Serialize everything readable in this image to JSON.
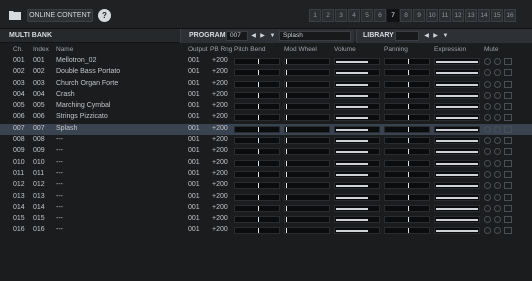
{
  "topbar": {
    "folder_icon": "folder-icon",
    "online_label": "ONLINE CONTENT",
    "help_label": "?",
    "pages": [
      "1",
      "2",
      "3",
      "4",
      "5",
      "6",
      "7",
      "8",
      "9",
      "10",
      "11",
      "12",
      "13",
      "14",
      "15",
      "16"
    ],
    "active_page": "7"
  },
  "header": {
    "multibank_label": "MULTI BANK",
    "program_label": "PROGRAM",
    "program_number": "007",
    "program_name": "Splash",
    "library_label": "LIBRARY",
    "library_value": ""
  },
  "columns": {
    "ch": "Ch.",
    "index": "Index",
    "name": "Name",
    "output": "Output",
    "pb_rng": "PB Rng",
    "pitch_bend": "Pitch Bend",
    "mod_wheel": "Mod Wheel",
    "volume": "Volume",
    "panning": "Panning",
    "expression": "Expression",
    "mute": "Mute"
  },
  "rows": [
    {
      "ch": "001",
      "index": "001",
      "name": "Mellotron_02",
      "output": "001",
      "pb": "+200"
    },
    {
      "ch": "002",
      "index": "002",
      "name": "Double Bass Portato",
      "output": "001",
      "pb": "+200"
    },
    {
      "ch": "003",
      "index": "003",
      "name": "Church Organ Forte",
      "output": "001",
      "pb": "+200"
    },
    {
      "ch": "004",
      "index": "004",
      "name": "Crash",
      "output": "001",
      "pb": "+200"
    },
    {
      "ch": "005",
      "index": "005",
      "name": "Marching Cymbal",
      "output": "001",
      "pb": "+200"
    },
    {
      "ch": "006",
      "index": "006",
      "name": "Strings Pizzicato",
      "output": "001",
      "pb": "+200"
    },
    {
      "ch": "007",
      "index": "007",
      "name": "Splash",
      "output": "001",
      "pb": "+200"
    },
    {
      "ch": "008",
      "index": "008",
      "name": "---",
      "output": "001",
      "pb": "+200"
    },
    {
      "ch": "009",
      "index": "009",
      "name": "---",
      "output": "001",
      "pb": "+200"
    },
    {
      "ch": "010",
      "index": "010",
      "name": "---",
      "output": "001",
      "pb": "+200"
    },
    {
      "ch": "011",
      "index": "011",
      "name": "---",
      "output": "001",
      "pb": "+200"
    },
    {
      "ch": "012",
      "index": "012",
      "name": "---",
      "output": "001",
      "pb": "+200"
    },
    {
      "ch": "013",
      "index": "013",
      "name": "---",
      "output": "001",
      "pb": "+200"
    },
    {
      "ch": "014",
      "index": "014",
      "name": "---",
      "output": "001",
      "pb": "+200"
    },
    {
      "ch": "015",
      "index": "015",
      "name": "---",
      "output": "001",
      "pb": "+200"
    },
    {
      "ch": "016",
      "index": "016",
      "name": "---",
      "output": "001",
      "pb": "+200"
    }
  ],
  "selected_row": 6,
  "levels": {
    "pitch_bend": 0.5,
    "mod_wheel": 0.0,
    "volume": 0.75,
    "panning": 0.5,
    "expression": 1.0
  },
  "colors": {
    "background": "#1a1c1e",
    "selected_row": "#3a4350",
    "bar_fill": "#cfd3d7",
    "active_page": "#0f1113"
  }
}
